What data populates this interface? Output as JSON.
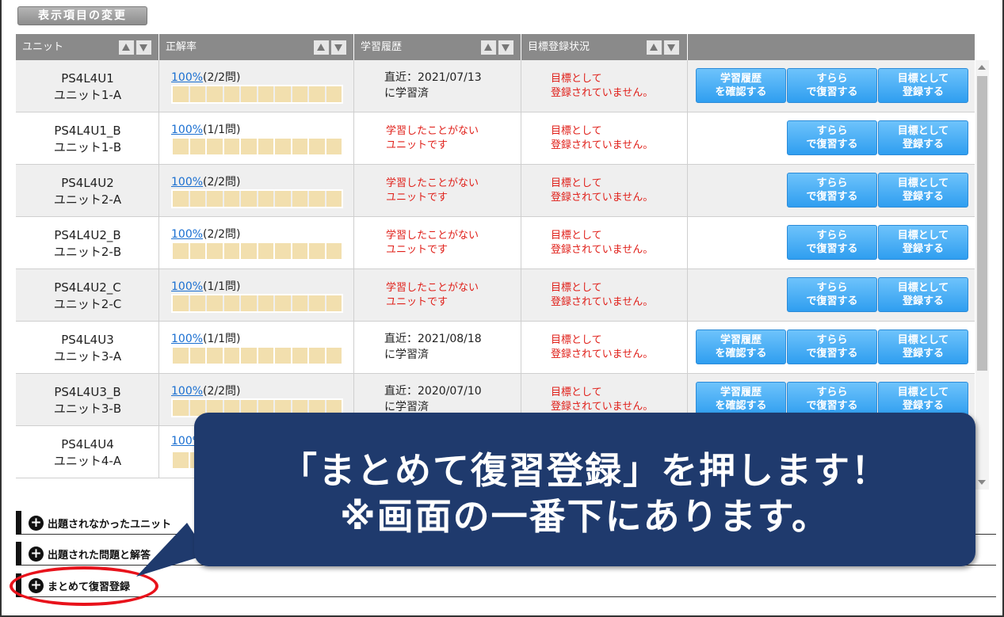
{
  "toolbar": {
    "change_display_label": "表示項目の変更"
  },
  "table": {
    "headers": [
      "ユニット",
      "正解率",
      "学習履歴",
      "目標登録状況",
      ""
    ],
    "rows": [
      {
        "code": "PS4L4U1",
        "name": "ユニット1-A",
        "rate_link": "100%",
        "rate_count": "(2/2問)",
        "history_line1": "直近：2021/07/13",
        "history_line2": "に学習済",
        "history_never": false,
        "goal_line1": "目標として",
        "goal_line2": "登録されていません。",
        "show_history_btn": true
      },
      {
        "code": "PS4L4U1_B",
        "name": "ユニット1-B",
        "rate_link": "100%",
        "rate_count": "(1/1問)",
        "history_line1": "学習したことがない",
        "history_line2": "ユニットです",
        "history_never": true,
        "goal_line1": "目標として",
        "goal_line2": "登録されていません。",
        "show_history_btn": false
      },
      {
        "code": "PS4L4U2",
        "name": "ユニット2-A",
        "rate_link": "100%",
        "rate_count": "(2/2問)",
        "history_line1": "学習したことがない",
        "history_line2": "ユニットです",
        "history_never": true,
        "goal_line1": "目標として",
        "goal_line2": "登録されていません。",
        "show_history_btn": false
      },
      {
        "code": "PS4L4U2_B",
        "name": "ユニット2-B",
        "rate_link": "100%",
        "rate_count": "(2/2問)",
        "history_line1": "学習したことがない",
        "history_line2": "ユニットです",
        "history_never": true,
        "goal_line1": "目標として",
        "goal_line2": "登録されていません。",
        "show_history_btn": false
      },
      {
        "code": "PS4L4U2_C",
        "name": "ユニット2-C",
        "rate_link": "100%",
        "rate_count": "(1/1問)",
        "history_line1": "学習したことがない",
        "history_line2": "ユニットです",
        "history_never": true,
        "goal_line1": "目標として",
        "goal_line2": "登録されていません。",
        "show_history_btn": false
      },
      {
        "code": "PS4L4U3",
        "name": "ユニット3-A",
        "rate_link": "100%",
        "rate_count": "(1/1問)",
        "history_line1": "直近：2021/08/18",
        "history_line2": "に学習済",
        "history_never": false,
        "goal_line1": "目標として",
        "goal_line2": "登録されていません。",
        "show_history_btn": true
      },
      {
        "code": "PS4L4U3_B",
        "name": "ユニット3-B",
        "rate_link": "100%",
        "rate_count": "(2/2問)",
        "history_line1": "直近：2020/07/10",
        "history_line2": "に学習済",
        "history_never": false,
        "goal_line1": "目標として",
        "goal_line2": "登録されていません。",
        "show_history_btn": true
      },
      {
        "code": "PS4L4U4",
        "name": "ユニット4-A",
        "rate_link": "100%",
        "rate_count": "",
        "history_line1": "",
        "history_line2": "",
        "history_never": false,
        "goal_line1": "",
        "goal_line2": "",
        "show_history_btn": false
      }
    ],
    "buttons": {
      "history_line1": "学習履歴",
      "history_line2": "を確認する",
      "review_line1": "すらら",
      "review_line2": "で復習する",
      "goal_line1": "目標として",
      "goal_line2": "登録する"
    },
    "progress_segments": 10
  },
  "sections": [
    {
      "label": "出題されなかったユニット"
    },
    {
      "label": "出題された問題と解答"
    },
    {
      "label": "まとめて復習登録"
    }
  ],
  "callout": {
    "line1": "「まとめて復習登録」を押します！",
    "line2": "※画面の一番下にあります。",
    "color": "#1f3a6d"
  },
  "colors": {
    "highlight": "#e8121b",
    "button": "#3aa7f3",
    "alert_text": "#e0201a",
    "link": "#1a6fd1"
  }
}
